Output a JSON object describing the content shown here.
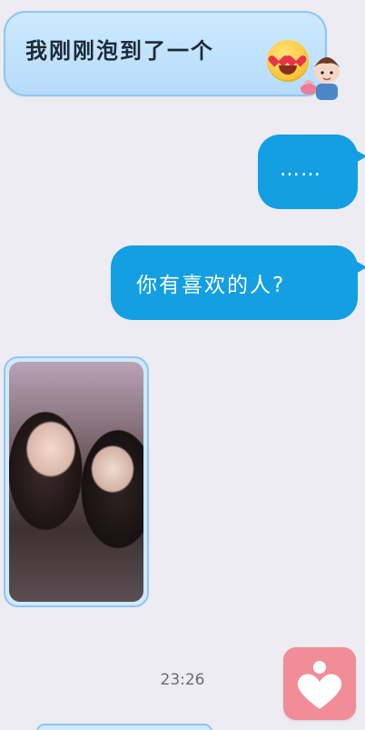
{
  "messages": {
    "incoming_text": "我刚刚泡到了一个",
    "outgoing_dots": "……",
    "outgoing_question": "你有喜欢的人?"
  },
  "timestamp": "23:26",
  "icons": {
    "emoji": "heart-eyes-emoji-icon",
    "sticker": "boy-sticker-icon",
    "heart_button": "heart-person-icon"
  },
  "colors": {
    "outgoing_bubble": "#139fe1",
    "incoming_bubble": "#cde9ff",
    "heart_button": "#f08d96",
    "background": "#ececf2"
  }
}
